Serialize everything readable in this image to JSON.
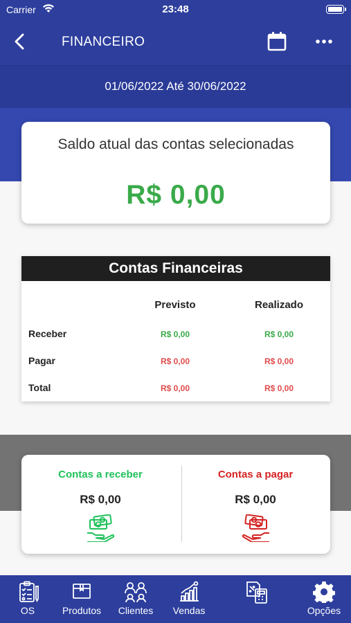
{
  "status_bar": {
    "carrier": "Carrier",
    "time": "23:48"
  },
  "header": {
    "title": "FINANCEIRO",
    "back_icon": "chevron-left-icon",
    "calendar_icon": "calendar-icon",
    "more_icon": "more-horizontal-icon"
  },
  "date_range": {
    "text": "01/06/2022 Até 30/06/2022"
  },
  "balance": {
    "label": "Saldo atual das contas selecionadas",
    "value": "R$ 0,00"
  },
  "accounts": {
    "title": "Contas Financeiras",
    "columns": [
      "Previsto",
      "Realizado"
    ],
    "rows": [
      {
        "label": "Receber",
        "previsto": "R$ 0,00",
        "realizado": "R$ 0,00"
      },
      {
        "label": "Pagar",
        "previsto": "R$ 0,00",
        "realizado": "R$ 0,00"
      },
      {
        "label": "Total",
        "previsto": "R$ 0,00",
        "realizado": "R$ 0,00"
      }
    ]
  },
  "summary": {
    "receber": {
      "title": "Contas a receber",
      "value": "R$ 0,00",
      "icon": "money-receive-hand-icon"
    },
    "pagar": {
      "title": "Contas a pagar",
      "value": "R$ 0,00",
      "icon": "money-pay-hand-icon"
    }
  },
  "tabbar": {
    "items": [
      {
        "label": "OS",
        "icon": "clipboard-checklist-icon"
      },
      {
        "label": "Produtos",
        "icon": "box-icon"
      },
      {
        "label": "Clientes",
        "icon": "people-icon"
      },
      {
        "label": "Vendas",
        "icon": "bar-chart-icon"
      },
      {
        "label": "",
        "icon": "calculator-document-icon"
      },
      {
        "label": "Opções",
        "icon": "gear-icon"
      }
    ]
  },
  "colors": {
    "primary": "#2d3e9d",
    "green": "#3aaa4a",
    "red": "#d42222",
    "receber_green": "#1fc15a"
  }
}
